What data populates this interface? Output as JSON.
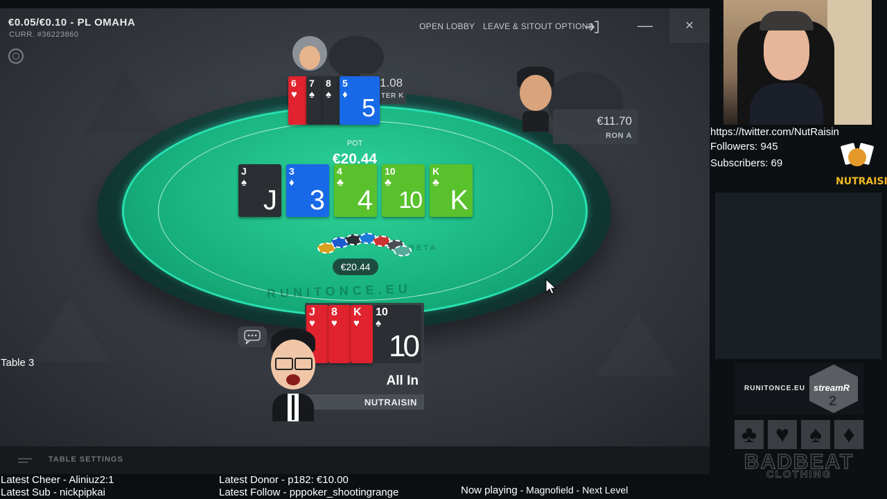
{
  "window": {
    "stakes": "€0.05/€0.10 - PL OMAHA",
    "curr": "CURR. #36223860",
    "open_lobby": "OPEN LOBBY",
    "leave_sitout": "LEAVE & SITOUT OPTIONS",
    "minimize": "—",
    "close": "✕"
  },
  "table": {
    "pot_label": "POT",
    "pot_value": "€20.44",
    "pot_chip_value": "€20.44",
    "watermark": "RUNITONCE.EU",
    "beta": "BETA",
    "board": [
      {
        "rank": "J",
        "suit": "♠",
        "color": "black"
      },
      {
        "rank": "3",
        "suit": "♦",
        "color": "blue"
      },
      {
        "rank": "4",
        "suit": "♣",
        "color": "green"
      },
      {
        "rank": "10",
        "suit": "♣",
        "color": "green"
      },
      {
        "rank": "K",
        "suit": "♣",
        "color": "green"
      }
    ]
  },
  "players": {
    "top": {
      "stack": "1.08",
      "name": "TER K",
      "cards": [
        {
          "rank": "6",
          "suit": "♥",
          "color": "red"
        },
        {
          "rank": "7",
          "suit": "♠",
          "color": "black"
        },
        {
          "rank": "8",
          "suit": "♠",
          "color": "black"
        },
        {
          "rank": "5",
          "suit": "♦",
          "color": "blue"
        }
      ]
    },
    "right": {
      "stack": "€11.70",
      "name": "RON A"
    },
    "hero": {
      "status": "All In",
      "name": "NUTRAISIN",
      "cards": [
        {
          "rank": "J",
          "suit": "♥",
          "color": "red"
        },
        {
          "rank": "8",
          "suit": "♥",
          "color": "red"
        },
        {
          "rank": "K",
          "suit": "♥",
          "color": "red"
        },
        {
          "rank": "10",
          "suit": "♠",
          "color": "black"
        }
      ]
    }
  },
  "table_settings": "TABLE SETTINGS",
  "overlay": {
    "table_label": "Table 3",
    "latest_cheer": "Latest Cheer - Aliniuz2:1",
    "latest_sub": "Latest Sub - nickpipkai",
    "latest_donor": "Latest Donor - p182: €10.00",
    "latest_follow": "Latest Follow - pppoker_shootingrange",
    "now_playing_label": "Now playing",
    "now_playing_track": " - Magnofield - Next Level",
    "twitter": "https://twitter.com/NutRaisin",
    "followers": "Followers: 945",
    "subscribers": "Subscribers: 69",
    "nutraisin_logo": "NUTRAISIN",
    "runitonce_banner": "RUNITONCE.EU",
    "streamr": "streamR",
    "streamr_num": "2",
    "badbeat_line1": "BADBEAT",
    "badbeat_line2": "CLOTHING"
  },
  "colors": {
    "felt": "#17b07d",
    "card_red": "#e0232e",
    "card_blue": "#1869e8",
    "card_green": "#58c12c",
    "card_black": "#2b2f33"
  }
}
